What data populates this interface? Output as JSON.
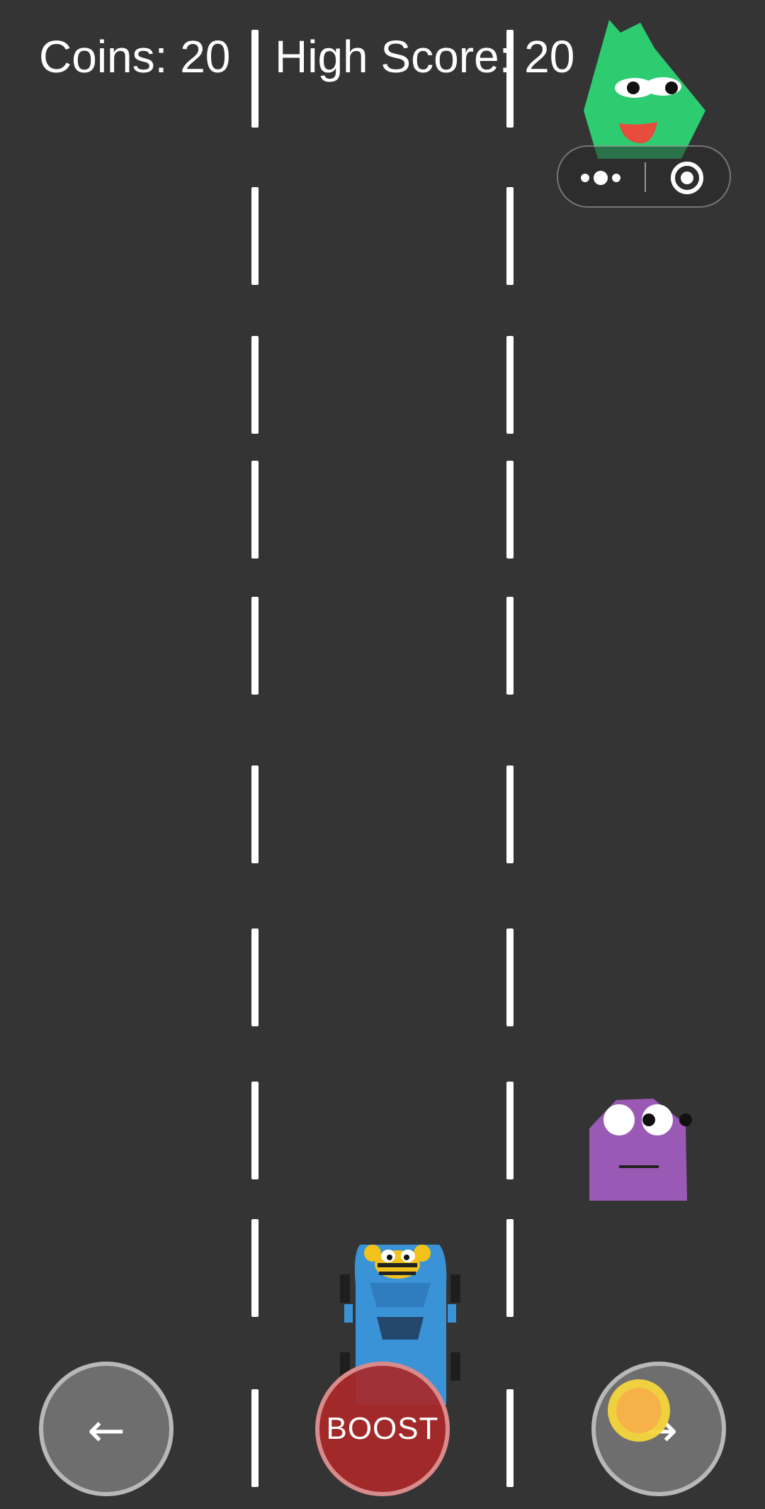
{
  "hud": {
    "coins_label": "Coins: 20",
    "high_score_label": "High Score: 20"
  },
  "game": {
    "coins": 20,
    "high_score": 20,
    "lanes": 3
  },
  "controls": {
    "left_label": "←",
    "boost_label": "BOOST",
    "right_label": "→"
  },
  "capsule": {
    "more_icon": "more-dots-icon",
    "close_icon": "target-close-icon"
  },
  "colors": {
    "road": "#343434",
    "lane_marking": "#ffffff",
    "player_car": "#3a93d6",
    "bee_yellow": "#f2c21b",
    "green_monster": "#2ecc71",
    "purple_monster": "#9b59b6",
    "coin": "#f5b93c",
    "boost": "#a82828"
  }
}
